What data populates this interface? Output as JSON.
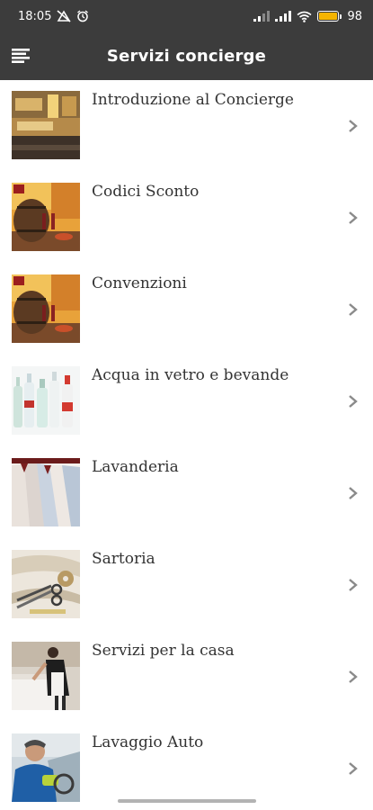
{
  "status_bar": {
    "time": "18:05",
    "battery_text": "98",
    "battery_level": 0.98,
    "icons": [
      "no-data-icon",
      "alarm-icon",
      "signal-icon",
      "signal-icon",
      "wifi-icon",
      "battery-icon"
    ]
  },
  "app_bar": {
    "title": "Servizi concierge",
    "menu_icon": "menu-icon"
  },
  "colors": {
    "bar_background": "#3c3c3c",
    "text": "#333333",
    "chevron": "#8a8a8a",
    "battery": "#f5b400"
  },
  "list": {
    "items": [
      {
        "label": "Introduzione al Concierge",
        "thumbnail": "concierge-desk-image"
      },
      {
        "label": "Codici Sconto",
        "thumbnail": "wine-barrel-image"
      },
      {
        "label": "Convenzioni",
        "thumbnail": "wine-barrel-image"
      },
      {
        "label": "Acqua in vetro e bevande",
        "thumbnail": "water-bottles-image"
      },
      {
        "label": "Lavanderia",
        "thumbnail": "shirts-on-hangers-image"
      },
      {
        "label": "Sartoria",
        "thumbnail": "tailor-tools-image"
      },
      {
        "label": "Servizi per la casa",
        "thumbnail": "housekeeping-image"
      },
      {
        "label": "Lavaggio Auto",
        "thumbnail": "car-wash-image"
      }
    ]
  }
}
